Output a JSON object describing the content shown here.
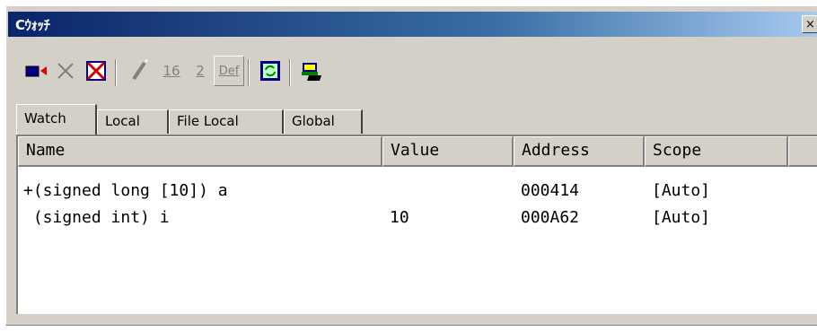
{
  "window": {
    "title": "Cｳｫｯﾁ",
    "close_glyph": "×"
  },
  "toolbar": {
    "buttons": [
      {
        "icon": "add-watch-icon"
      },
      {
        "icon": "delete-icon"
      },
      {
        "icon": "delete-all-icon"
      },
      {
        "icon": "edit-value-icon"
      },
      {
        "label": "16",
        "icon": "hex-radix-icon"
      },
      {
        "label": "2",
        "icon": "binary-radix-icon"
      },
      {
        "label": "Def",
        "icon": "default-radix-icon"
      },
      {
        "icon": "refresh-icon"
      },
      {
        "icon": "record-icon"
      }
    ]
  },
  "tabs": [
    {
      "label": "Watch",
      "active": true
    },
    {
      "label": "Local"
    },
    {
      "label": "File Local"
    },
    {
      "label": "Global"
    }
  ],
  "table": {
    "columns": [
      "Name",
      "Value",
      "Address",
      "Scope"
    ],
    "rows": [
      {
        "name": "+(signed long [10]) a",
        "value": "",
        "address": "000414",
        "scope": "[Auto]"
      },
      {
        "name": " (signed int) i",
        "value": "10",
        "address": "000A62",
        "scope": "[Auto]"
      }
    ]
  }
}
